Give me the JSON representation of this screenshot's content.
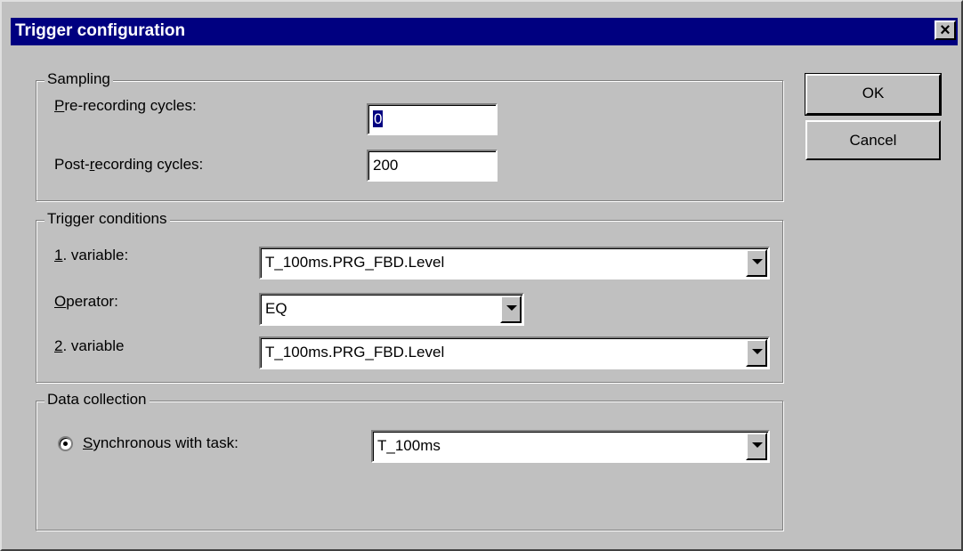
{
  "window": {
    "title": "Trigger configuration",
    "close_glyph": "×"
  },
  "sampling": {
    "label": "Sampling",
    "pre_label_accel": "P",
    "pre_label_rest": "re-recording cycles:",
    "pre_value": "0",
    "post_label_pre": "Post-",
    "post_label_accel": "r",
    "post_label_rest": "ecording cycles:",
    "post_value": "200"
  },
  "trigger": {
    "label": "Trigger conditions",
    "var1_accel": "1",
    "var1_rest": ". variable:",
    "var1_value": "T_100ms.PRG_FBD.Level",
    "operator_accel": "O",
    "operator_rest": "perator:",
    "operator_value": "EQ",
    "var2_accel": "2",
    "var2_rest": ". variable",
    "var2_value": "T_100ms.PRG_FBD.Level"
  },
  "data_collection": {
    "label": "Data collection",
    "sync_accel": "S",
    "sync_rest": "ynchronous with task:",
    "task_value": "T_100ms",
    "sync_selected": true
  },
  "buttons": {
    "ok": "OK",
    "cancel": "Cancel"
  },
  "colors": {
    "face": "#c0c0c0",
    "titlebar": "#000080",
    "highlight": "#ffffff",
    "shadow": "#808080"
  }
}
